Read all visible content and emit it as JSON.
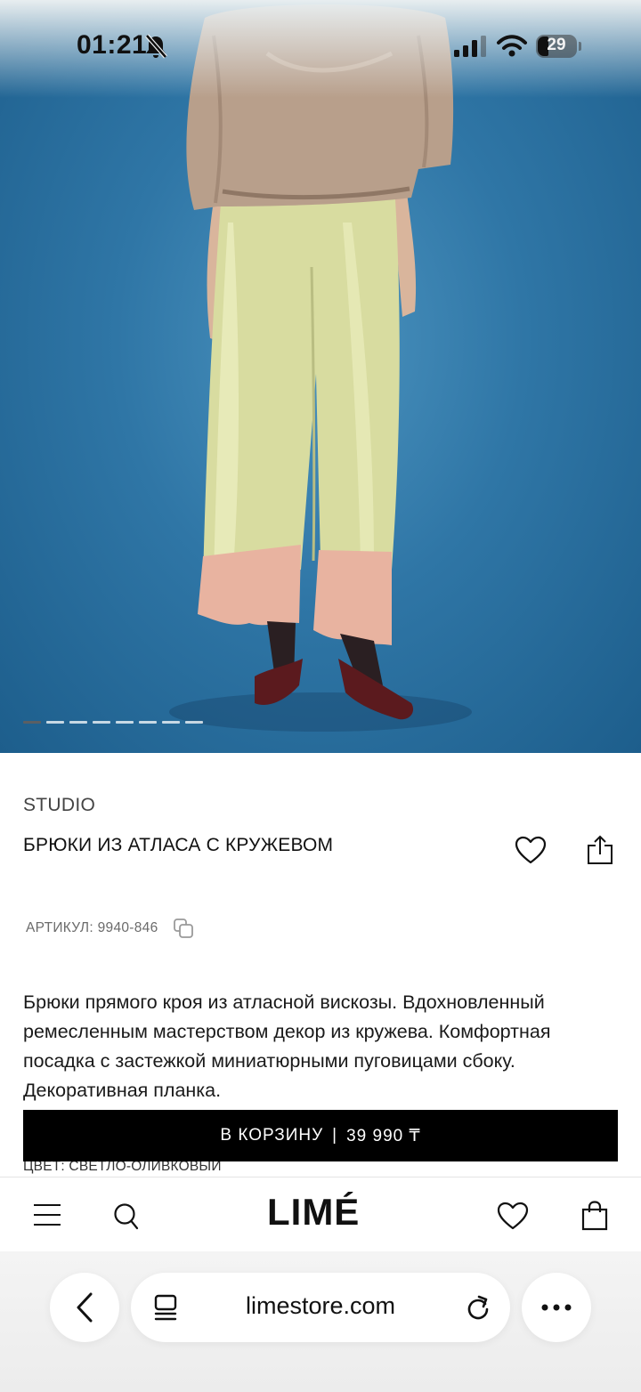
{
  "status_bar": {
    "time": "01:21",
    "battery": "29",
    "icons": [
      "bell-slash-icon",
      "cellular-signal-icon",
      "wifi-icon",
      "battery-icon"
    ]
  },
  "carousel": {
    "total_slides": 8,
    "active_index": 0
  },
  "product": {
    "brand": "STUDIO",
    "title": "БРЮКИ ИЗ АТЛАСА С КРУЖЕВОМ",
    "sku": "АРТИКУЛ: 9940-846",
    "description": "Брюки прямого кроя из атласной вискозы. Вдохновленный ремесленным мастерством декор из кружева. Комфортная посадка с застежкой миниатюрными пуговицами сбоку. Декоративная планка.",
    "color_label": "ЦВЕТ: СВЕТЛО-ОЛИВКОВЫЙ"
  },
  "cart_button": {
    "label": "В КОРЗИНУ",
    "separator": "|",
    "price": "39 990 ₸"
  },
  "bottom_nav": {
    "logo": "LIMÉ",
    "icons": [
      "menu-icon",
      "search-icon",
      "heart-icon",
      "shopping-bag-icon"
    ]
  },
  "browser": {
    "url": "limestore.com",
    "icons": [
      "back-icon",
      "tabs-icon",
      "reload-icon",
      "more-icon"
    ]
  },
  "colors": {
    "background_blue": "#2f76a6",
    "cart_button": "#000000",
    "text": "#111111"
  }
}
